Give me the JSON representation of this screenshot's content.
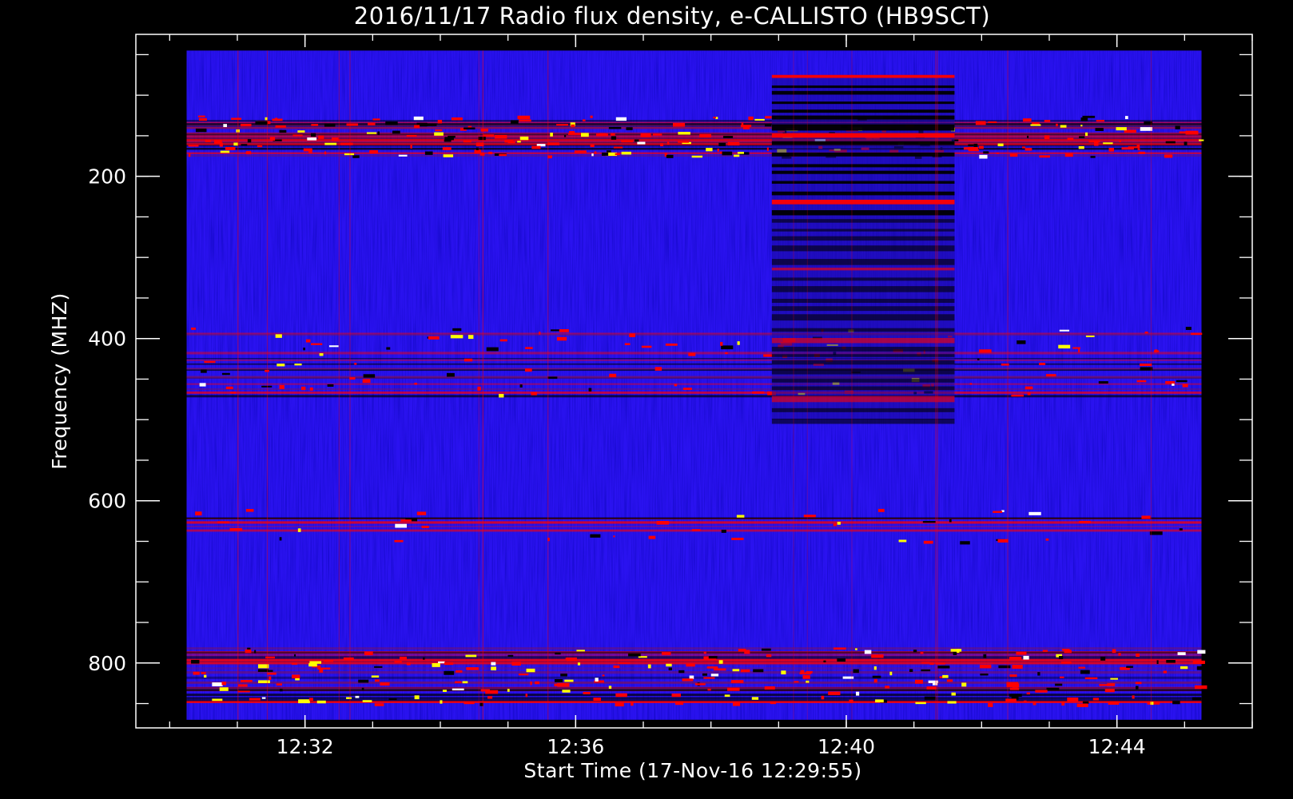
{
  "chart_data": {
    "type": "heatmap",
    "title": "2016/11/17  Radio flux density, e-CALLISTO (HB9SCT)",
    "xlabel": "Start Time (17-Nov-16 12:29:55)",
    "ylabel": "Frequency (MHZ)",
    "x_ticks": [
      "12:32",
      "12:36",
      "12:40",
      "12:44"
    ],
    "y_ticks": [
      200,
      400,
      600,
      800
    ],
    "x_range_minutes": [
      29.5,
      46.0
    ],
    "data_extent_minutes": [
      30.25,
      45.25
    ],
    "y_range_mhz": [
      25,
      880
    ],
    "data_extent_mhz": [
      45,
      870
    ],
    "y_inverted": true,
    "colormap": [
      "#000000",
      "#0000ff",
      "#ff0000",
      "#ffff00",
      "#ffffff"
    ],
    "background_color": "#2a12f0",
    "bands": [
      {
        "label": "bright band",
        "freq_mhz": [
          125,
          175
        ],
        "level": "high"
      },
      {
        "label": "band",
        "freq_mhz": [
          385,
          470
        ],
        "level": "medium"
      },
      {
        "label": "band",
        "freq_mhz": [
          610,
          650
        ],
        "level": "low"
      },
      {
        "label": "band",
        "freq_mhz": [
          780,
          850
        ],
        "level": "high"
      }
    ],
    "events": [
      {
        "label": "interference block",
        "time_minutes": [
          38.9,
          41.6
        ],
        "freq_mhz": [
          75,
          500
        ]
      }
    ]
  }
}
